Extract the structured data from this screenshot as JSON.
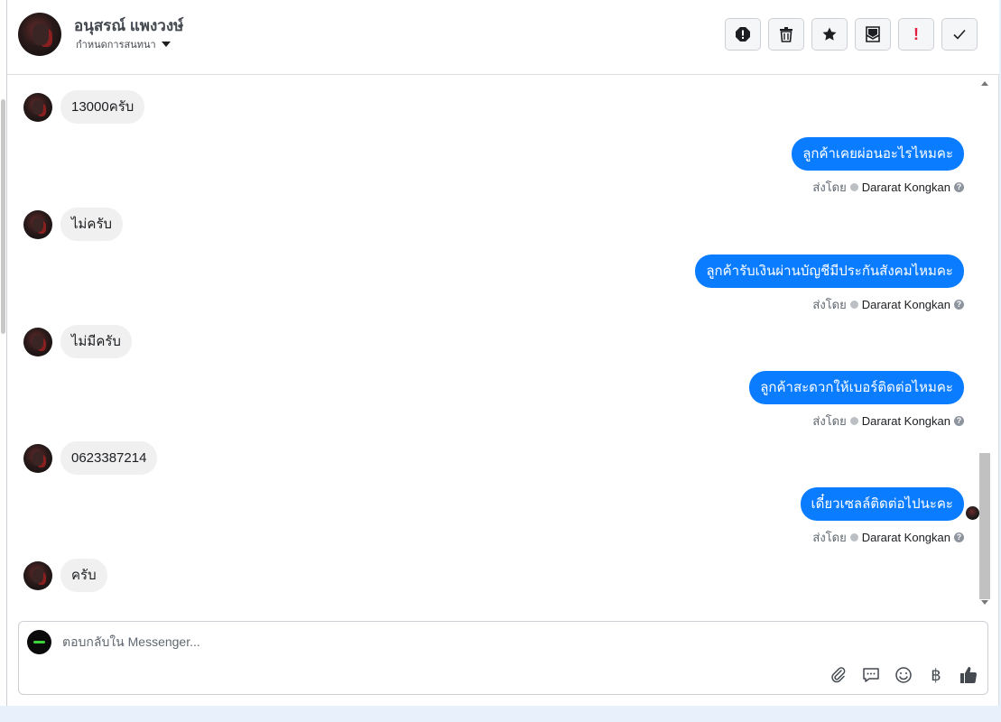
{
  "header": {
    "contact_name": "อนุสรณ์ แพงวงษ์",
    "assign_label": "กำหนดการสนทนา",
    "actions": [
      {
        "name": "spam-icon",
        "title": "Mark as spam"
      },
      {
        "name": "trash-icon",
        "title": "Delete"
      },
      {
        "name": "star-icon",
        "title": "Star"
      },
      {
        "name": "mark-unread-icon",
        "title": "Mark as unread"
      },
      {
        "name": "follow-up-icon",
        "title": "Follow up"
      },
      {
        "name": "check-icon",
        "title": "Done"
      }
    ],
    "follow_up_glyph": "!"
  },
  "messages": [
    {
      "direction": "in",
      "text": "13000ครับ"
    },
    {
      "direction": "out",
      "text": "ลูกค้าเคยผ่อนอะไรไหมคะ",
      "sent_by_label": "ส่งโดย",
      "agent": "Dararat Kongkan"
    },
    {
      "direction": "in",
      "text": "ไม่ครับ"
    },
    {
      "direction": "out",
      "text": "ลูกค้ารับเงินผ่านบัญชีมีประกันสังคมไหมคะ",
      "sent_by_label": "ส่งโดย",
      "agent": "Dararat Kongkan"
    },
    {
      "direction": "in",
      "text": "ไม่มีครับ"
    },
    {
      "direction": "out",
      "text": "ลูกค้าสะดวกให้เบอร์ติดต่อไหมคะ",
      "sent_by_label": "ส่งโดย",
      "agent": "Dararat Kongkan"
    },
    {
      "direction": "in",
      "text": "0623387214"
    },
    {
      "direction": "out",
      "text": "เดี๋ยวเซลล์ติดต่อไปนะคะ",
      "sent_by_label": "ส่งโดย",
      "agent": "Dararat Kongkan",
      "seen": true
    },
    {
      "direction": "in",
      "text": "ครับ"
    }
  ],
  "composer": {
    "placeholder": "ตอบกลับใน Messenger...",
    "value": "",
    "tools": [
      "paperclip-icon",
      "saved-replies-icon",
      "emoji-icon",
      "baht-icon",
      "thumbs-up-icon"
    ],
    "currency_glyph": "฿"
  },
  "colors": {
    "outgoing_bubble": "#0a7cff",
    "incoming_bubble": "#f0f0f0",
    "page_bg": "#e7f0fb"
  }
}
